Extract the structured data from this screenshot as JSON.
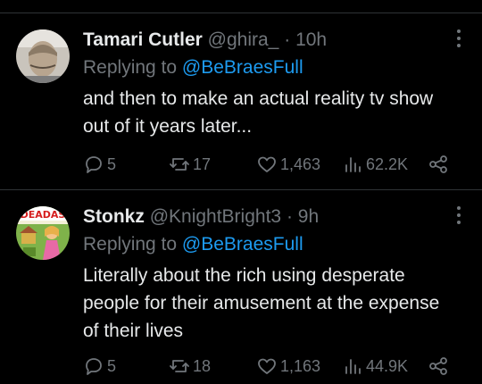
{
  "tweets": [
    {
      "display_name": "Tamari Cutler",
      "handle": "@ghira_",
      "dot": "·",
      "time": "10h",
      "replying_prefix": "Replying to",
      "replying_to": "@BeBraesFull",
      "text": "and then to make an actual reality tv show out of it years later...",
      "replies": "5",
      "reposts": "17",
      "likes": "1,463",
      "views": "62.2K"
    },
    {
      "display_name": "Stonkz",
      "handle": "@KnightBright3",
      "dot": "·",
      "time": "9h",
      "replying_prefix": "Replying to",
      "replying_to": "@BeBraesFull",
      "text": "Literally about the rich using desperate people for their amusement at the expense of their lives",
      "replies": "5",
      "reposts": "18",
      "likes": "1,163",
      "views": "44.9K",
      "avatar_text": "DEADAS"
    }
  ],
  "colors": {
    "background": "#000000",
    "text": "#e7e9ea",
    "secondary": "#71767b",
    "mention": "#1d9bf0",
    "divider": "#2f3336"
  }
}
